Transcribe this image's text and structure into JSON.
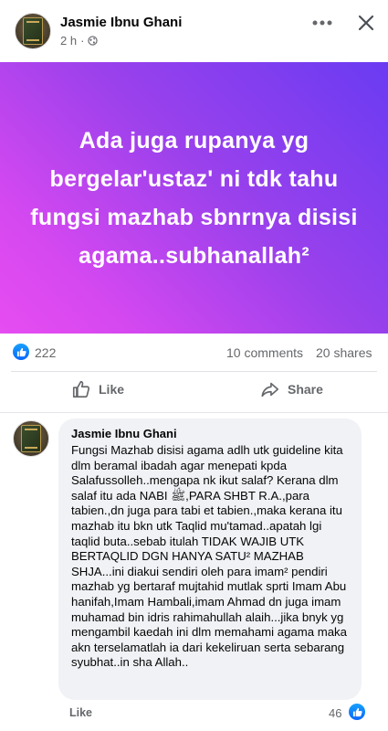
{
  "post": {
    "author": "Jasmie Ibnu Ghani",
    "time": "2 h",
    "separator": "·",
    "banner_text": "Ada juga rupanya yg bergelar'ustaz' ni tdk tahu fungsi mazhab sbnrnya disisi agama..subhanallah²",
    "banner_colors": [
      "#6a3bf2",
      "#e64df1"
    ]
  },
  "stats": {
    "reactions": "222",
    "comments": "10 comments",
    "shares": "20 shares"
  },
  "actions": {
    "like_label": "Like",
    "share_label": "Share"
  },
  "comment": {
    "author": "Jasmie Ibnu Ghani",
    "text": "Fungsi Mazhab disisi agama adlh utk guideline kita dlm beramal ibadah agar menepati kpda Salafussolleh..mengapa nk ikut salaf? Kerana dlm salaf itu ada NABI ﷺ,PARA SHBT R.A.,para tabien.,dn  juga para tabi et tabien.,maka kerana  itu mazhab itu  bkn utk Taqlid mu'tamad..apatah lgi taqlid buta..sebab itulah TIDAK WAJIB UTK BERTAQLID DGN HANYA SATU² MAZHAB SHJA...ini diakui sendiri oleh para imam² pendiri mazhab yg bertaraf mujtahid mutlak sprti Imam Abu hanifah,Imam Hambali,imam Ahmad dn juga imam muhamad bin idris rahimahullah alaih...jika bnyk yg mengambil kaedah ini dlm memahami agama maka akn terselamatlah ia dari kekeliruan serta sebarang syubhat..in sha Allah..",
    "like_label": "Like",
    "reaction_count": "46"
  },
  "icons": {
    "more": "more-horizontal-icon",
    "close": "close-icon",
    "globe": "globe-icon",
    "like": "thumbs-up-icon",
    "share": "share-arrow-icon"
  },
  "colors": {
    "accent": "#0866ff",
    "secondary_text": "#65676b",
    "comment_bg": "#f0f2f5"
  }
}
